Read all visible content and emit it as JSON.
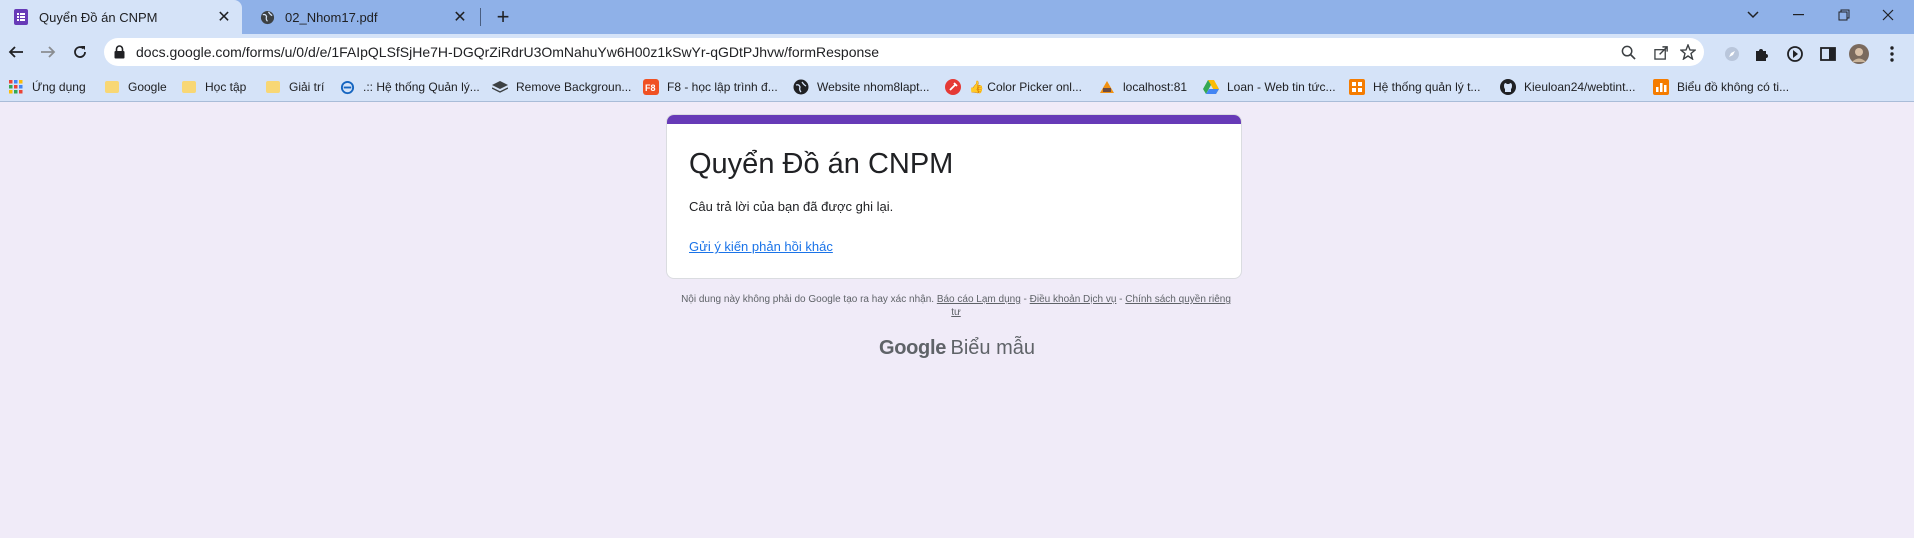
{
  "tabs": [
    {
      "title": "Quyển Đồ án CNPM",
      "icon": "google-forms-icon",
      "active": true
    },
    {
      "title": "02_Nhom17.pdf",
      "icon": "globe-icon",
      "active": false
    }
  ],
  "new_tab_label": "+",
  "address_bar": {
    "url": "docs.google.com/forms/u/0/d/e/1FAIpQLSfSjHe7H-DGQrZiRdrU3OmNahuYw6H00z1kSwYr-qGDtPJhvw/formResponse"
  },
  "bookmarks": [
    {
      "label": "Ứng dụng",
      "icon": "apps-grid-icon"
    },
    {
      "label": "Google",
      "icon": "folder-icon"
    },
    {
      "label": "Học tập",
      "icon": "folder-icon"
    },
    {
      "label": "Giải trí",
      "icon": "folder-icon"
    },
    {
      "label": ".:: Hệ thống Quản lý...",
      "icon": "edu-system-icon"
    },
    {
      "label": "Remove Backgroun...",
      "icon": "remove-bg-icon"
    },
    {
      "label": "F8 - học lập trình đ...",
      "icon": "f8-icon"
    },
    {
      "label": "Website nhom8lapt...",
      "icon": "website-icon"
    },
    {
      "label": "👍 Color Picker onl...",
      "icon": "color-picker-icon"
    },
    {
      "label": "localhost:81",
      "icon": "localhost-icon"
    },
    {
      "label": "Loan - Web tin tức...",
      "icon": "google-drive-icon"
    },
    {
      "label": "Hệ thống quản lý t...",
      "icon": "management-system-icon"
    },
    {
      "label": "Kieuloan24/webtint...",
      "icon": "github-icon"
    },
    {
      "label": "Biểu đồ không có ti...",
      "icon": "chart-icon"
    }
  ],
  "form": {
    "title": "Quyển Đồ án CNPM",
    "confirmation": "Câu trả lời của bạn đã được ghi lại.",
    "another_response_link": "Gửi ý kiến phản hồi khác",
    "accent_color": "#673ab7"
  },
  "footer": {
    "disclaimer": "Nội dung này không phải do Google tạo ra hay xác nhận.",
    "report_abuse": "Báo cáo Lạm dụng",
    "terms": "Điều khoản Dịch vụ",
    "privacy": "Chính sách quyền riêng tư",
    "separator": " - "
  },
  "brand": {
    "google": "Google",
    "product": "Biểu mẫu"
  }
}
